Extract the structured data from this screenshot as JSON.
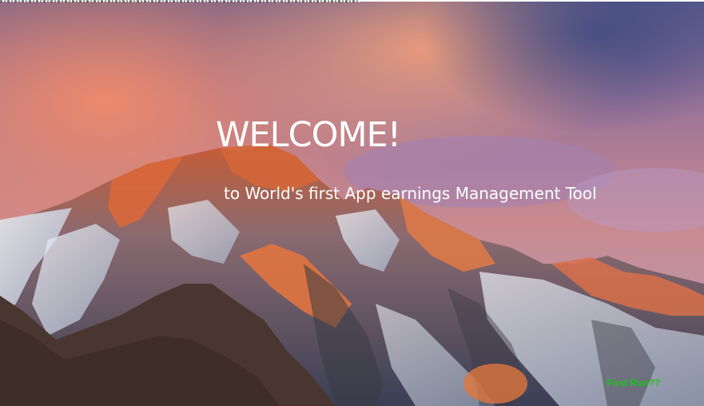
{
  "welcome": {
    "title": "WELCOME!",
    "subtitle": "to World's first App earnings Management Tool"
  },
  "first_run": {
    "label": "First Run??",
    "color": "#19c419"
  },
  "background": {
    "image": "mountain-sunset",
    "sky_top": "#5b5c92",
    "sky_glow": "#e6896a",
    "sky_right": "#8a7fb4",
    "rock_lit": "#d86a3a",
    "snow": "#dfe6f0",
    "rock_shadow": "#3b3a44",
    "foreground_rock": "#4a3630"
  }
}
